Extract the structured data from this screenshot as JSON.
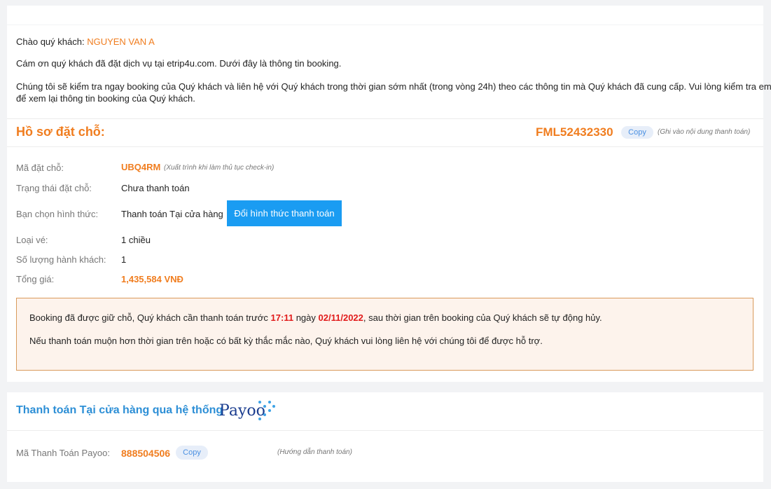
{
  "greeting": {
    "prefix": "Chào quý khách:",
    "name": "NGUYEN VAN A"
  },
  "intro": {
    "line1": "Cám ơn quý khách đã đặt dịch vụ tại etrip4u.com. Dưới đây là thông tin booking.",
    "line2a": "Chúng tôi sẽ kiểm tra ngay booking của Quý khách và liên hệ với Quý khách trong thời gian sớm nhất (trong vòng 24h) theo các thông tin mà Quý khách đã cung cấp. Vui lòng kiểm tra email",
    "line2b": "để xem lại thông tin booking của Quý khách."
  },
  "booking_header": {
    "title": "Hồ sơ đặt chỗ:",
    "code": "FML52432330",
    "copy_label": "Copy",
    "hint": "(Ghi vào nội dung thanh toán)"
  },
  "details": {
    "booking_code_label": "Mã đặt chỗ:",
    "booking_code": "UBQ4RM",
    "booking_code_hint": "(Xuất trình khi làm thủ tục check-in)",
    "status_label": "Trạng thái đặt chỗ:",
    "status": "Chưa thanh toán",
    "method_label": "Bạn chọn hình thức:",
    "method": "Thanh toán Tại cửa hàng",
    "change_method_button": "Đổi hình thức thanh toán",
    "ticket_type_label": "Loại vé:",
    "ticket_type": "1 chiều",
    "passengers_label": "Số lượng hành khách:",
    "passengers": "1",
    "total_label": "Tổng giá:",
    "total": "1,435,584 VNĐ"
  },
  "notice": {
    "line1_a": "Booking đã được giữ chỗ, Quý khách cần thanh toán trước",
    "time": "17:11",
    "line1_b": "ngày",
    "date": "02/11/2022",
    "line1_c": ", sau thời gian trên booking của Quý khách sẽ tự động hủy.",
    "line2": "Nếu thanh toán muộn hơn thời gian trên hoặc có bất kỳ thắc mắc nào, Quý khách vui lòng liên hệ với chúng tôi để được hỗ trợ."
  },
  "payoo": {
    "title": "Thanh toán Tại cửa hàng qua hệ thống",
    "logo_text": "Payoo",
    "code_label": "Mã Thanh Toán Payoo:",
    "code": "888504506",
    "copy_label": "Copy",
    "guide_link": "(Hướng dẫn thanh toán)"
  },
  "colors": {
    "accent": "#f07d1f",
    "button": "#1a9cf2",
    "alert": "#e11b1b",
    "payoo": "#2d8fd6"
  }
}
